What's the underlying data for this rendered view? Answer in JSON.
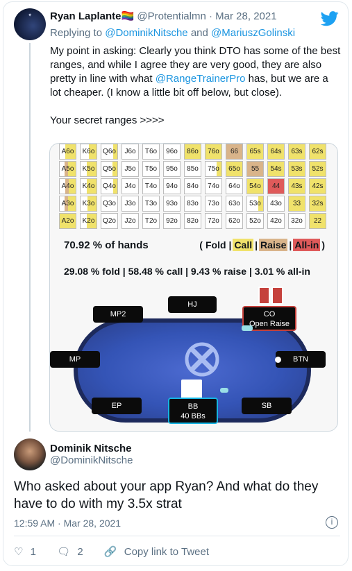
{
  "tweet1": {
    "name": "Ryan Laplante",
    "emoji": "🏳️‍🌈",
    "handle": "@Protentialmn",
    "sep": "·",
    "date": "Mar 28, 2021",
    "replying_prefix": "Replying to",
    "mention1": "@DominikNitsche",
    "and": "and",
    "mention2": "@MariuszGolinski",
    "text_a": "My point in asking: Clearly you think DTO has some of the best ranges, and while I agree they are very good, they are also pretty in line with what",
    "text_link": "@RangeTrainerPro",
    "text_b": "has, but we are a lot cheaper. (I know a little bit off below, but close).",
    "text_c": "Your secret ranges >>>>"
  },
  "card": {
    "colors": {
      "call": "#f0e26b",
      "raise": "#d9b48a",
      "allin": "#df5a5a"
    },
    "grid": [
      [
        [
          "A6o",
          0.65,
          "c"
        ],
        [
          "K6o",
          0.5,
          "c"
        ],
        [
          "Q6o",
          0.25,
          "c"
        ],
        [
          "J6o",
          0,
          "c"
        ],
        [
          "T6o",
          0,
          "c"
        ],
        [
          "96o",
          0,
          "c"
        ],
        [
          "86o",
          1,
          "c"
        ],
        [
          "76o",
          1,
          "c"
        ],
        [
          "66",
          1,
          "r"
        ],
        [
          "65s",
          1,
          "c"
        ],
        [
          "64s",
          1,
          "c"
        ],
        [
          "63s",
          1,
          "c"
        ],
        [
          "62s",
          1,
          "c"
        ]
      ],
      [
        [
          "A5o",
          0.7,
          "r"
        ],
        [
          "K5o",
          0.6,
          "c"
        ],
        [
          "Q5o",
          0.3,
          "c"
        ],
        [
          "J5o",
          0,
          "c"
        ],
        [
          "T5o",
          0,
          "c"
        ],
        [
          "95o",
          0,
          "c"
        ],
        [
          "85o",
          0,
          "c"
        ],
        [
          "75o",
          0.3,
          "c"
        ],
        [
          "65o",
          1,
          "c"
        ],
        [
          "55",
          1,
          "r"
        ],
        [
          "54s",
          1,
          "c"
        ],
        [
          "53s",
          1,
          "c"
        ],
        [
          "52s",
          1,
          "c"
        ]
      ],
      [
        [
          "A4o",
          0.65,
          "r"
        ],
        [
          "K4o",
          0.6,
          "c"
        ],
        [
          "Q4o",
          0.25,
          "c"
        ],
        [
          "J4o",
          0,
          "c"
        ],
        [
          "T4o",
          0,
          "c"
        ],
        [
          "94o",
          0,
          "c"
        ],
        [
          "84o",
          0,
          "c"
        ],
        [
          "74o",
          0,
          "c"
        ],
        [
          "64o",
          0,
          "c"
        ],
        [
          "54o",
          1,
          "c"
        ],
        [
          "44",
          1,
          "a"
        ],
        [
          "43s",
          1,
          "c"
        ],
        [
          "42s",
          1,
          "c"
        ]
      ],
      [
        [
          "A3o",
          0.7,
          "r"
        ],
        [
          "K3o",
          0.55,
          "c"
        ],
        [
          "Q3o",
          0,
          "c"
        ],
        [
          "J3o",
          0,
          "c"
        ],
        [
          "T3o",
          0,
          "c"
        ],
        [
          "93o",
          0,
          "c"
        ],
        [
          "83o",
          0,
          "c"
        ],
        [
          "73o",
          0,
          "c"
        ],
        [
          "63o",
          0,
          "c"
        ],
        [
          "53o",
          0.3,
          "c"
        ],
        [
          "43o",
          0,
          "c"
        ],
        [
          "33",
          1,
          "c"
        ],
        [
          "32s",
          1,
          "c"
        ]
      ],
      [
        [
          "A2o",
          1,
          "c"
        ],
        [
          "K2o",
          0.6,
          "c"
        ],
        [
          "Q2o",
          0,
          "c"
        ],
        [
          "J2o",
          0,
          "c"
        ],
        [
          "T2o",
          0,
          "c"
        ],
        [
          "92o",
          0,
          "c"
        ],
        [
          "82o",
          0,
          "c"
        ],
        [
          "72o",
          0,
          "c"
        ],
        [
          "62o",
          0,
          "c"
        ],
        [
          "52o",
          0,
          "c"
        ],
        [
          "42o",
          0,
          "c"
        ],
        [
          "32o",
          0,
          "c"
        ],
        [
          "22",
          1,
          "c"
        ]
      ]
    ],
    "hands_pct": "70.92 % of hands",
    "legend": {
      "open": "(",
      "fold": "Fold",
      "bar": "|",
      "call": "Call",
      "raise": "Raise",
      "allin": "All-in",
      "close": ")"
    },
    "summary": "29.08 % fold | 58.48 % call | 9.43 % raise | 3.01 % all-in",
    "seats": {
      "hj": "HJ",
      "mp2": "MP2",
      "co": "CO",
      "co_sub": "Open Raise",
      "mp": "MP",
      "btn": "BTN",
      "ep": "EP",
      "sb": "SB",
      "bb": "BB",
      "bb_sub": "40 BBs"
    }
  },
  "tweet2": {
    "name": "Dominik Nitsche",
    "handle": "@DominikNitsche",
    "text": "Who asked about your app Ryan? And what do they have to do with my 3.5x strat",
    "time": "12:59 AM · Mar 28, 2021"
  },
  "actions": {
    "likes": "1",
    "replies": "2",
    "copy": "Copy link to Tweet"
  }
}
